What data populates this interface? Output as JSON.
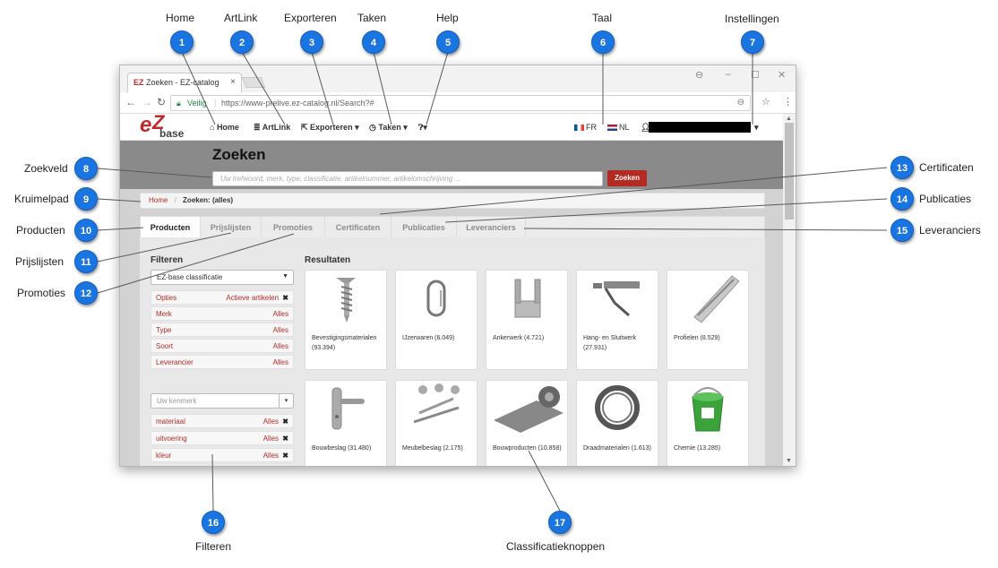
{
  "browser": {
    "tab_title": "Zoeken - EZ-catalog",
    "tab_close": "×",
    "favicon": "EZ",
    "window_controls": [
      "⊖",
      "–",
      "☐",
      "✕"
    ],
    "url_secure": "Veilig",
    "url": "https://www-prelive.ez-catalog.nl/Search?#"
  },
  "logo": {
    "letters_e": "e",
    "letters_z": "Z",
    "word": "base"
  },
  "navbar": {
    "home": "Home",
    "artlink": "ArtLink",
    "exporteren": "Exporteren",
    "taken": "Taken",
    "help_caret": "▾",
    "lang_fr": "FR",
    "lang_nl": "NL"
  },
  "hero": {
    "title": "Zoeken",
    "search_placeholder": "Uw trefwoord, merk, type, classificatie, artikelnummer, artikelomschrijving ...",
    "search_button": "Zoeken"
  },
  "breadcrumb": {
    "home": "Home",
    "separator": "/",
    "current": "Zoeken: (alles)"
  },
  "tabs": [
    "Producten",
    "Prijslijsten",
    "Promoties",
    "Certificaten",
    "Publicaties",
    "Leveranciers"
  ],
  "filters": {
    "title": "Filteren",
    "classification_select": "EZ-base classificatie",
    "rows": [
      {
        "key": "Opties",
        "value": "Actieve artikelen",
        "remove": "✖"
      },
      {
        "key": "Merk",
        "value": "Alles",
        "remove": ""
      },
      {
        "key": "Type",
        "value": "Alles",
        "remove": ""
      },
      {
        "key": "Soort",
        "value": "Alles",
        "remove": ""
      },
      {
        "key": "Leverancier",
        "value": "Alles",
        "remove": ""
      }
    ],
    "kenmerk_placeholder": "Uw kenmerk",
    "kenmerk_rows": [
      {
        "key": "materiaal",
        "value": "Alles",
        "remove": "✖"
      },
      {
        "key": "uitvoering",
        "value": "Alles",
        "remove": "✖"
      },
      {
        "key": "kleur",
        "value": "Alles",
        "remove": "✖"
      }
    ]
  },
  "results": {
    "title": "Resultaten",
    "cards": [
      {
        "label": "Bevestigingsmaterialen (93.394)",
        "icon": "screw-icon"
      },
      {
        "label": "IJzerwaren (6.049)",
        "icon": "carabiner-icon"
      },
      {
        "label": "Ankerwerk (4.721)",
        "icon": "anchor-bracket-icon"
      },
      {
        "label": "Hang- en Sluitwerk (27.931)",
        "icon": "door-closer-icon"
      },
      {
        "label": "Profielen (8.529)",
        "icon": "profile-icon"
      },
      {
        "label": "Bouwbeslag (31.480)",
        "icon": "door-handle-icon"
      },
      {
        "label": "Meubelbeslag (2.175)",
        "icon": "furniture-fittings-icon"
      },
      {
        "label": "Bouwproducten (10.858)",
        "icon": "roll-icon"
      },
      {
        "label": "Draadmaterialen (1.613)",
        "icon": "wire-coil-icon"
      },
      {
        "label": "Chemie (13.285)",
        "icon": "paint-bucket-icon"
      }
    ]
  },
  "callouts": [
    {
      "n": "1",
      "label": "Home"
    },
    {
      "n": "2",
      "label": "ArtLink"
    },
    {
      "n": "3",
      "label": "Exporteren"
    },
    {
      "n": "4",
      "label": "Taken"
    },
    {
      "n": "5",
      "label": "Help"
    },
    {
      "n": "6",
      "label": "Taal"
    },
    {
      "n": "7",
      "label": "Instellingen"
    },
    {
      "n": "8",
      "label": "Zoekveld"
    },
    {
      "n": "9",
      "label": "Kruimelpad"
    },
    {
      "n": "10",
      "label": "Producten"
    },
    {
      "n": "11",
      "label": "Prijslijsten"
    },
    {
      "n": "12",
      "label": "Promoties"
    },
    {
      "n": "13",
      "label": "Certificaten"
    },
    {
      "n": "14",
      "label": "Publicaties"
    },
    {
      "n": "15",
      "label": "Leveranciers"
    },
    {
      "n": "16",
      "label": "Filteren"
    },
    {
      "n": "17",
      "label": "Classificatieknoppen"
    }
  ],
  "colors": {
    "callout": "#1b75e0",
    "brand_red": "#b42a23",
    "hero_gray": "#8a8a8a"
  }
}
